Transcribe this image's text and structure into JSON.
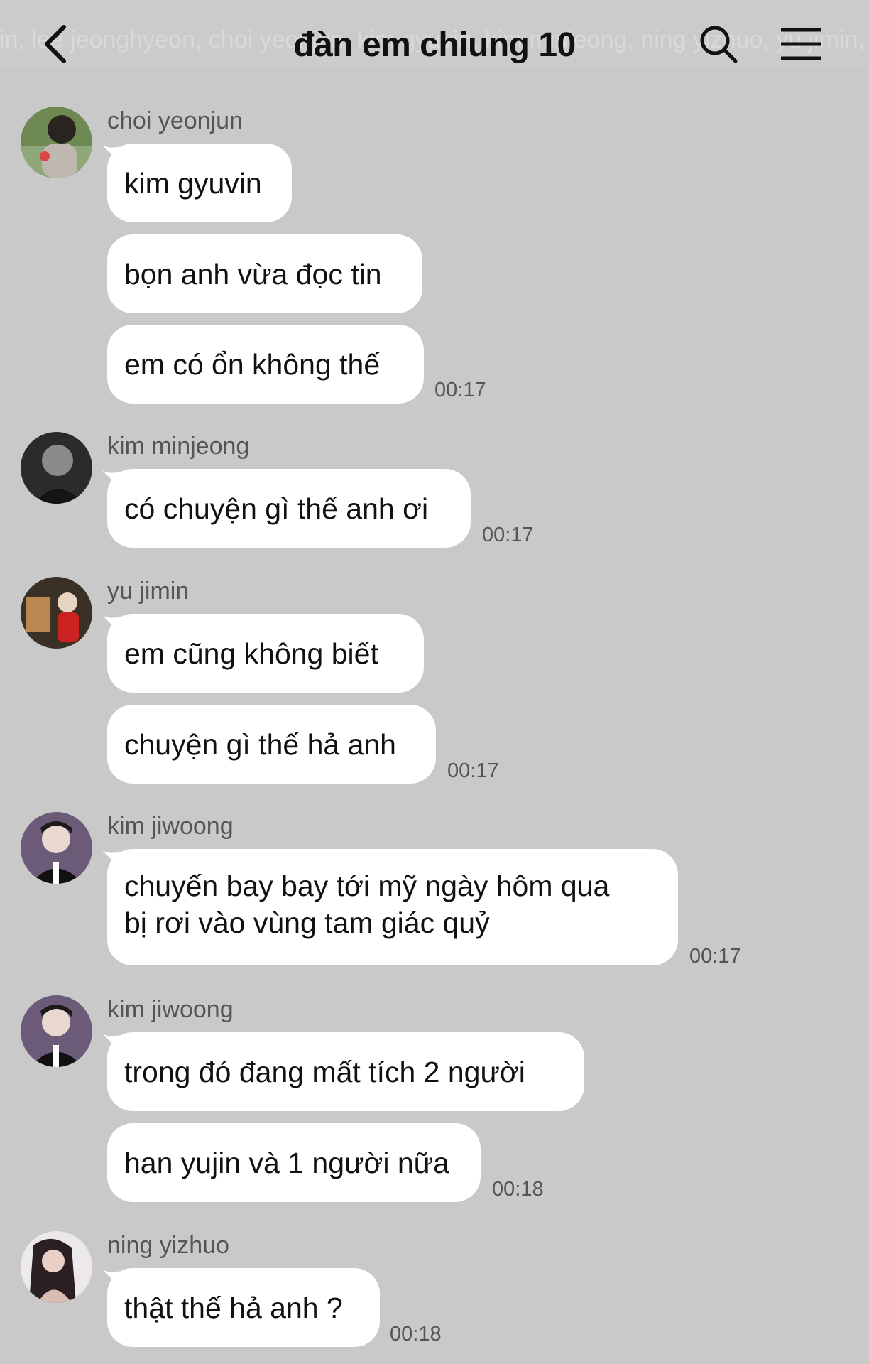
{
  "header": {
    "title": "đàn em chiung 10",
    "members_strip": "oin, lee jeonghyeon, choi yeonjun, kim gyuvin, kim minjeong, ning yizhuo, yu jimin, kim jiwoong, han yujin"
  },
  "icons": {
    "back": "chevron-left-icon",
    "search": "search-icon",
    "menu": "hamburger-menu-icon"
  },
  "messages": [
    {
      "sender": "choi yeonjun",
      "avatar": "avatar-photo",
      "bubbles": [
        "kim gyuvin",
        "bọn anh vừa đọc tin",
        "em có ổn không thế"
      ],
      "time": "00:17"
    },
    {
      "sender": "kim minjeong",
      "avatar": "avatar-photo",
      "bubbles": [
        "có chuyện gì thế anh ơi"
      ],
      "time": "00:17"
    },
    {
      "sender": "yu jimin",
      "avatar": "avatar-photo",
      "bubbles": [
        "em cũng không biết",
        "chuyện gì thế hả anh"
      ],
      "time": "00:17"
    },
    {
      "sender": "kim jiwoong",
      "avatar": "avatar-photo",
      "bubbles": [
        "chuyến bay bay tới mỹ ngày hôm qua\nbị rơi vào vùng tam giác quỷ"
      ],
      "time": "00:17"
    },
    {
      "sender": "kim jiwoong",
      "avatar": "avatar-photo",
      "bubbles": [
        "trong đó đang mất tích 2 người",
        "han yujin và 1 người nữa"
      ],
      "time": "00:18"
    },
    {
      "sender": "ning yizhuo",
      "avatar": "avatar-photo",
      "bubbles": [
        "thật thế hả anh ?"
      ],
      "time": "00:18"
    }
  ]
}
